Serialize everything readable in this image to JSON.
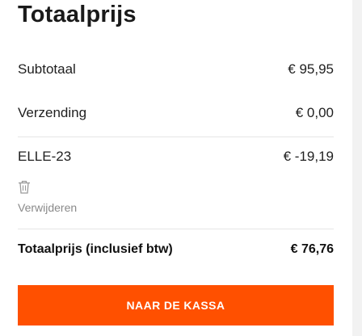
{
  "summary": {
    "title": "Totaalprijs",
    "subtotal": {
      "label": "Subtotaal",
      "value": "€ 95,95"
    },
    "shipping": {
      "label": "Verzending",
      "value": "€ 0,00"
    },
    "discount": {
      "label": "ELLE-23",
      "value": "€ -19,19",
      "remove_label": "Verwijderen",
      "remove_icon": "trash-icon"
    },
    "total": {
      "label": "Totaalprijs (inclusief btw)",
      "value": "€ 76,76"
    },
    "checkout_label": "NAAR DE KASSA"
  },
  "colors": {
    "accent": "#ff5000",
    "muted_text": "#8a8a8a",
    "divider": "#e6e6e6"
  }
}
